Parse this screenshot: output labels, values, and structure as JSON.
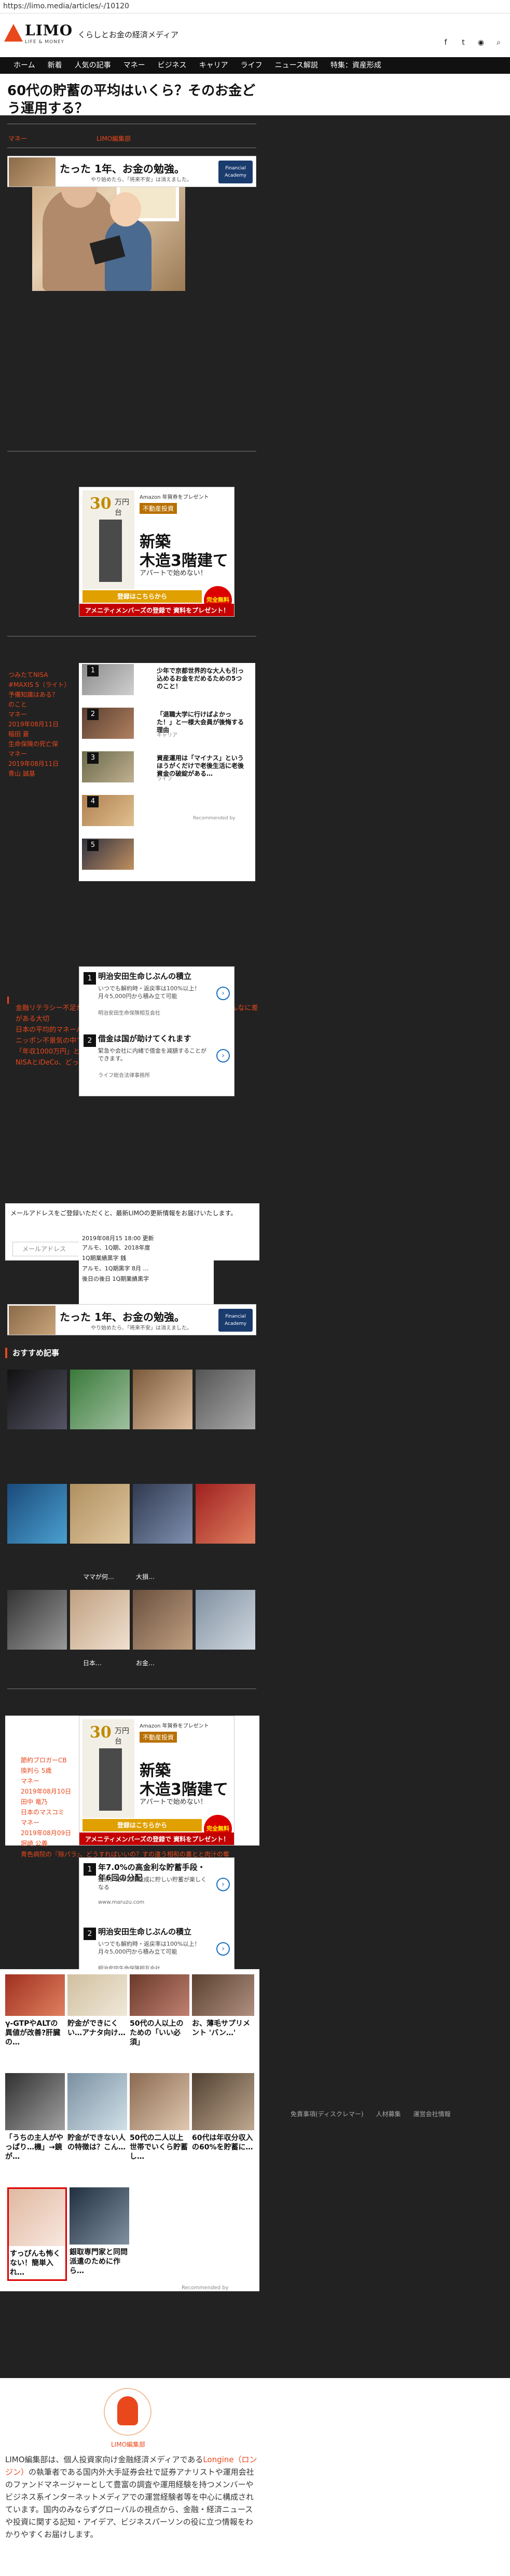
{
  "browser": {
    "url": "https://limo.media/articles/-/10120"
  },
  "header": {
    "logo_text": "LIMO",
    "logo_sub": "LIFE & MONEY",
    "tagline": "くらしとお金の経済メディア",
    "icons": [
      "facebook-icon",
      "twitter-icon",
      "rss-icon",
      "search-icon"
    ]
  },
  "nav": [
    "ホーム",
    "新着",
    "人気の記事",
    "マネー",
    "ビジネス",
    "キャリア",
    "ライフ",
    "ニュース解説",
    "特集：資産形成"
  ],
  "article": {
    "title": "60代の貯蓄の平均はいくら？そのお金どう運用する？",
    "category": "マネー",
    "author": "LIMO編集部"
  },
  "top_banner": {
    "headline": "たった 1年、お金の勉強。",
    "sub": "やり始めたら、「将来不安」は消えました。",
    "brand": "Financial Academy"
  },
  "square_ad": {
    "tower_num": "30",
    "tower_unit": "万円台",
    "tag": "Amazon 年賀券をプレゼント",
    "pill": "不動産投資",
    "big1": "新築",
    "big2": "木造3階建て",
    "small1": "アパートで始めない！",
    "button": "登録はこちらから",
    "bottom": "アメニティメンバーズの登録で 資料をプレゼント！",
    "seal": "完全無料"
  },
  "related": [
    {
      "label": "つみたてNISA",
      "kind": "o"
    },
    {
      "label": "#MAXIS S（ライト）",
      "kind": "o"
    },
    {
      "label": "予備知識はある？",
      "kind": "o"
    },
    {
      "label": "のこと",
      "kind": "o"
    },
    {
      "label": "マネー",
      "kind": "o"
    },
    {
      "label": "2019年08月11日",
      "kind": "o"
    },
    {
      "label": "稲田 蒼",
      "kind": "o"
    },
    {
      "label": "生命保険の死亡保",
      "kind": "o"
    },
    {
      "label": "マネー",
      "kind": "o"
    },
    {
      "label": "2019年08月11日",
      "kind": "o"
    },
    {
      "label": "青山 誠基",
      "kind": "o"
    }
  ],
  "native_items": [
    {
      "num": "1",
      "title": "少年で京都世界的な大人も引っ込めるお金をだめるための5つのこと！",
      "src": ""
    },
    {
      "num": "2",
      "title": "「退職大学に行けばよかった！」と一様大会員が後悔する理由",
      "src": "キャリア"
    },
    {
      "num": "3",
      "title": "資産運用は「マイナス」というほうがくだけで老後生活に老後資金の破綻がある…",
      "src": "ライフ"
    },
    {
      "num": "4",
      "title": "",
      "src": ""
    },
    {
      "num": "5",
      "title": "",
      "src": ""
    }
  ],
  "native_recommended": "Recommended by",
  "rect_ad": {
    "rows": [
      {
        "num": "1",
        "title": "明治安田生命じぶんの積立",
        "desc": "いつでも解約時・返戻率は100%以上！月々5,000円から積み立て可能",
        "src": "明治安田生命保険相互会社"
      },
      {
        "num": "2",
        "title": "借金は国が助けてくれます",
        "desc": "緊急や会社に内緒で借金を減額することができます。",
        "src": "ライフ総合法律事務所"
      }
    ]
  },
  "article_links": [
    "金融リテラシー不足が理由にされる若者の資産形成…年収別で見るとこんなに差がある大切",
    "日本の平均的マネーパースンはどのくらいの資産を持っているのか",
    "ニッポン不景気の中で…日本人の知識",
    "「年収1000万円」と「貯蓄1000万円」、後悔度が高いのはどっち！？",
    "NISAとiDeCo、どっちから始めるべき？30〜40代投資の落とし穴"
  ],
  "mail": {
    "text": "メールアドレスをご登録いただくと、最新LIMOの更新情報をお届けいたします。",
    "placeholder": "メールアドレス",
    "button": "登録"
  },
  "mini_news": {
    "headline1": "アルモ、1Q期、2018年度",
    "headline2": "1Q期業績黒字 銭",
    "date": "2019年08月15 18:00 更新",
    "items": [
      "アルモ、1Q期黒字 8月 …",
      "後日の後日 1Q期業績黒字"
    ]
  },
  "recommend_head": "おすすめ記事",
  "grid_labels": [
    "ママが何…",
    "大損…",
    "日本…",
    "お金…"
  ],
  "lower_list": [
    {
      "label": "節約ブロガーCB",
      "kind": "o"
    },
    {
      "label": "換判ら 5歳",
      "kind": "o"
    },
    {
      "label": "マネー",
      "kind": "o"
    },
    {
      "label": "2019年08月10日",
      "kind": "o"
    },
    {
      "label": "田中 竜乃",
      "kind": "o"
    },
    {
      "label": "日本のマスコミ",
      "kind": "o"
    },
    {
      "label": "マネー",
      "kind": "o"
    },
    {
      "label": "2019年08月09日",
      "kind": "o"
    },
    {
      "label": "堀崎 公義",
      "kind": "o"
    }
  ],
  "ad2": {
    "rows": [
      {
        "num": "1",
        "title": "年7.0%の高金利な貯蓄手段・年6回の分配",
        "desc": "返済、元本目標達成に貯しい貯蓄が楽しくなる",
        "src": "www.maruzu.com"
      },
      {
        "num": "2",
        "title": "明治安田生命じぶんの積立",
        "desc": "いつでも解約時・返戻率は100%以上！月々5,000円から積み立て可能",
        "src": "明治安田生命保険相互会社"
      }
    ]
  },
  "bottom_link": "青色病院の『除パラ』、どうすればいいの？すの違う相和の裏とと肉汁の奪",
  "card_captions": [
    "γ-GTPやALTの異値が改善?肝臓の…",
    "貯金ができにくい…アナタ向け…",
    "50代の人以上のための「いい必須」",
    "お、薄毛サプリメント 'バン…'"
  ],
  "card_captions2": [
    "「うちの主人がやっぱり…機」→鏡が…",
    "貯金ができない人の特徴は？こん…",
    "50代の二人以上世帯でいくら貯蓄し…",
    "60代は年収分収入の60%を貯蓄に…"
  ],
  "card_captions3": [
    "すっぴんも怖くない！簡単入れ…",
    "銀取専門家と同問 派遣のために作ら…"
  ],
  "footer_links": [
    "免責事項(ディスクレマー)",
    "人材募集",
    "運営会社情報"
  ],
  "recommended_by": "Recommended by",
  "editor": {
    "name": "LIMO編集部",
    "desc_pre": "LIMO編集部は、個人投資家向け金融経済メディアである",
    "desc_link": "Longine（ロンジン）",
    "desc_post": "の執筆者である国内外大手証券会社で証券アナリストや運用会社のファンドマネージャーとして豊富の調査や運用経験を持つメンバーやビジネス系インターネットメディアでの運営経験者等を中心に構成されています。国内のみならずグローバルの視点から、金融・経済ニュースや投資に関する記知・アイデア、ビジネスパーソンの役に立つ情報をわかりやすくお届けします。"
  }
}
